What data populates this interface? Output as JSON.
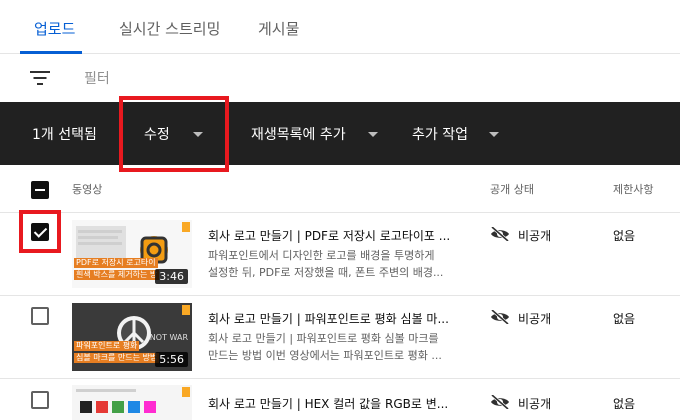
{
  "tabs": [
    {
      "label": "업로드",
      "active": true
    },
    {
      "label": "실시간 스트리밍",
      "active": false
    },
    {
      "label": "게시물",
      "active": false
    }
  ],
  "filter": {
    "placeholder": "필터"
  },
  "actionbar": {
    "selected_count_label": "1개 선택됨",
    "edit_label": "수정",
    "add_to_playlist_label": "재생목록에 추가",
    "more_actions_label": "추가 작업"
  },
  "table": {
    "headers": {
      "video": "동영상",
      "visibility": "공개 상태",
      "restrictions": "제한사항"
    },
    "rows": [
      {
        "checked": true,
        "title": "회사 로고 만들기 | PDF로 저장시 로고타이포 ...",
        "desc_line1": "파워포인트에서 디자인한 로고를 배경을 투명하게",
        "desc_line2": "설정한 뒤, PDF로 저장했을 때, 폰트 주변의 배경...",
        "duration": "3:46",
        "thumb_caption1": "PDF로 저장시 로고타이",
        "thumb_caption2": "흰색 박스를 제거하는 방",
        "visibility": "비공개",
        "restriction": "없음"
      },
      {
        "checked": false,
        "title": "회사 로고 만들기 | 파워포인트로 평화 심볼 마...",
        "desc_line1": "회사 로고 만들기 | 파워포인트로 평화 심볼 마크를",
        "desc_line2": "만드는 방법 이번 영상에서는 파워포인트로 평화 ...",
        "duration": "5:56",
        "thumb_caption1": "파워포인트로 평화",
        "thumb_caption2": "심볼 마크를 만드는 방법",
        "thumb_text": "NOT WAR",
        "visibility": "비공개",
        "restriction": "없음"
      },
      {
        "checked": false,
        "title": "회사 로고 만들기 | HEX 컬러 값을 RGB로 변...",
        "visibility": "비공개",
        "restriction": "없음"
      }
    ]
  },
  "colors": {
    "accent": "#065fd4",
    "actionbar_bg": "#212121",
    "highlight": "#e8191f",
    "thumb_orange": "#f39c12"
  },
  "icons": {
    "filter": "filter-lines-icon",
    "caret": "caret-down-icon",
    "visibility": "eye-off-icon",
    "checkbox": "checkbox-icon"
  }
}
